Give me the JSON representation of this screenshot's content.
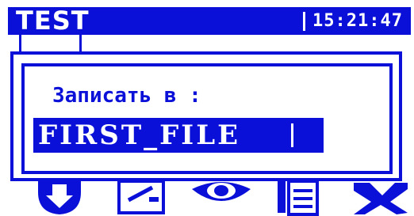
{
  "header": {
    "title": "TEST",
    "clock": "15:21:47"
  },
  "dialog": {
    "prompt": "Записать в :",
    "filename_value": "FIRST_FILE"
  },
  "icons": [
    "download-icon",
    "edit-icon",
    "view-icon",
    "files-icon",
    "tools-icon"
  ],
  "colors": {
    "accent": "#0a10d8",
    "background": "#ffffff"
  }
}
